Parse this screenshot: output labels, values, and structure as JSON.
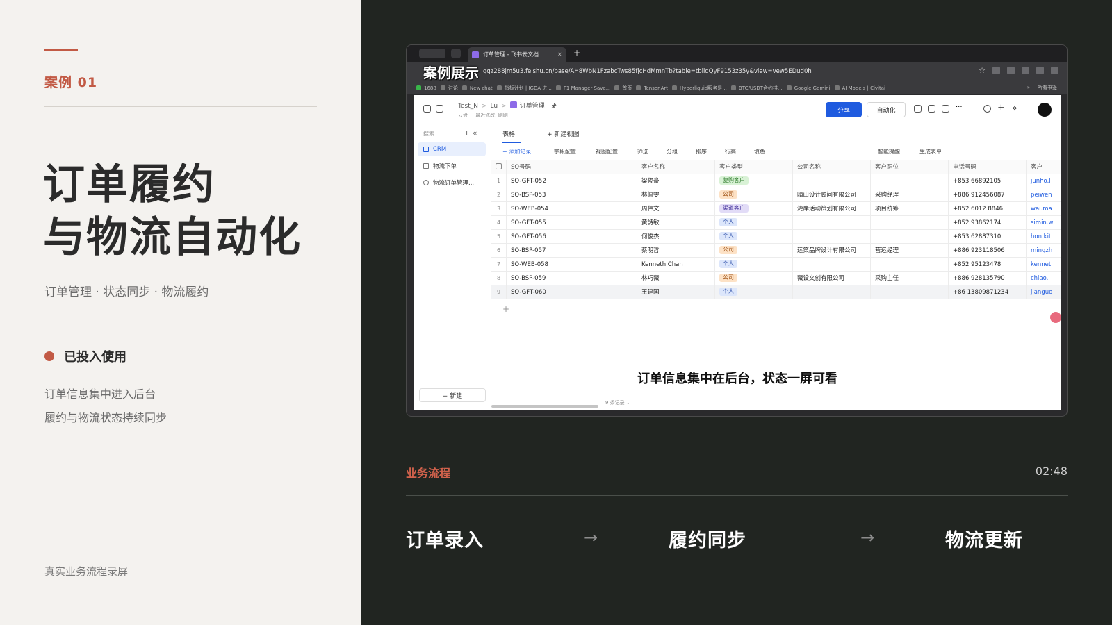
{
  "left": {
    "case_label": "案例 01",
    "title_line1": "订单履约",
    "title_line2": "与物流自动化",
    "subtitle": "订单管理 · 状态同步 · 物流履约",
    "status": "已投入使用",
    "desc_line1": "订单信息集中进入后台",
    "desc_line2": "履约与物流状态持续同步",
    "footer": "真实业务流程录屏"
  },
  "right": {
    "flow_label": "业务流程",
    "time": "02:48",
    "steps": [
      "订单录入",
      "履约同步",
      "物流更新"
    ],
    "arrow": "→"
  },
  "browser": {
    "overlay_label": "案例展示",
    "tab_title": "订单管理 - 飞书云文档",
    "tab_close": "×",
    "new_tab": "+",
    "url": "qqz288jm5u3.feishu.cn/base/AH8WbN1FzabcTws85fjcHdMmnTb?table=tblidQyF9153z35y&view=vew5EDud0h",
    "star": "☆",
    "bookmarks": [
      "1688",
      "讨论",
      "New chat",
      "指标计划 | IGDA 进...",
      "F1 Manager Save...",
      "首页",
      "Tensor.Art",
      "Hyperliquid服务是...",
      "BTC/USDT合约排...",
      "Google Gemini",
      "AI Models | Civitai"
    ],
    "bookmarks_more": "»",
    "bookmarks_folder": "所有书签"
  },
  "app": {
    "breadcrumb": [
      "Test_N",
      "Lu",
      "订单管理"
    ],
    "crumb_sep": ">",
    "pin": "🖈",
    "crumb_sub_location": "云盘",
    "crumb_sub_modified": "最近修改: 刚刚",
    "share": "分享",
    "automation": "自动化",
    "search_placeholder": "搜索",
    "sidebar_add": "+ «",
    "sidebar_items": [
      "CRM",
      "物流下单",
      "物流订单管理..."
    ],
    "sidebar_new": "+ 新建",
    "view_tabs": [
      "表格",
      "+ 新建视图"
    ],
    "toolbar": [
      "+ 添加记录",
      "字段配置",
      "视图配置",
      "筛选",
      "分组",
      "排序",
      "行高",
      "填色",
      "智能提醒",
      "生成表单"
    ],
    "columns": [
      "SO号码",
      "客户名称",
      "客户类型",
      "公司名称",
      "客户职位",
      "电话号码",
      "客户"
    ],
    "rows": [
      {
        "n": "1",
        "so": "SO-GFT-052",
        "name": "梁俊豪",
        "type": "复购客户",
        "company": "",
        "position": "",
        "phone": "+853 66892105",
        "email": "junho.l"
      },
      {
        "n": "2",
        "so": "SO-BSP-053",
        "name": "林佩雯",
        "type": "公司",
        "company": "晴山设计顾问有限公司",
        "position": "采购经理",
        "phone": "+886 912456087",
        "email": "peiwen"
      },
      {
        "n": "3",
        "so": "SO-WEB-054",
        "name": "周伟文",
        "type": "渠道客户",
        "company": "湾岸活动策划有限公司",
        "position": "项目统筹",
        "phone": "+852 6012 8846",
        "email": "wai.ma"
      },
      {
        "n": "4",
        "so": "SO-GFT-055",
        "name": "黄詩敏",
        "type": "个人",
        "company": "",
        "position": "",
        "phone": "+852 93862174",
        "email": "simin.w"
      },
      {
        "n": "5",
        "so": "SO-GFT-056",
        "name": "何俊杰",
        "type": "个人",
        "company": "",
        "position": "",
        "phone": "+853 62887310",
        "email": "hon.kit"
      },
      {
        "n": "6",
        "so": "SO-BSP-057",
        "name": "蔡明哲",
        "type": "公司",
        "company": "远策品牌设计有限公司",
        "position": "营运经理",
        "phone": "+886 923118506",
        "email": "mingzh"
      },
      {
        "n": "7",
        "so": "SO-WEB-058",
        "name": "Kenneth Chan",
        "type": "个人",
        "company": "",
        "position": "",
        "phone": "+852 95123478",
        "email": "kennet"
      },
      {
        "n": "8",
        "so": "SO-BSP-059",
        "name": "林巧薇",
        "type": "公司",
        "company": "薇设文创有限公司",
        "position": "采购主任",
        "phone": "+886 928135790",
        "email": "chiao."
      },
      {
        "n": "9",
        "so": "SO-GFT-060",
        "name": "王建国",
        "type": "个人",
        "company": "",
        "position": "",
        "phone": "+86 13809871234",
        "email": "jianguo"
      }
    ],
    "add_row": "+",
    "record_count": "9 条记录 ⌄",
    "caption": "订单信息集中在后台，状态一屏可看"
  },
  "tag_colors": {
    "复购客户": {
      "bg": "#d9f2d6",
      "fg": "#2c7a2a"
    },
    "公司": {
      "bg": "#fde2c6",
      "fg": "#9a4b0c"
    },
    "渠道客户": {
      "bg": "#e2dcf7",
      "fg": "#4b3aa0"
    },
    "个人": {
      "bg": "#dce6fb",
      "fg": "#2b4ea8"
    }
  },
  "colors": {
    "accent": "#c25a45",
    "primary": "#1f5bdf"
  }
}
